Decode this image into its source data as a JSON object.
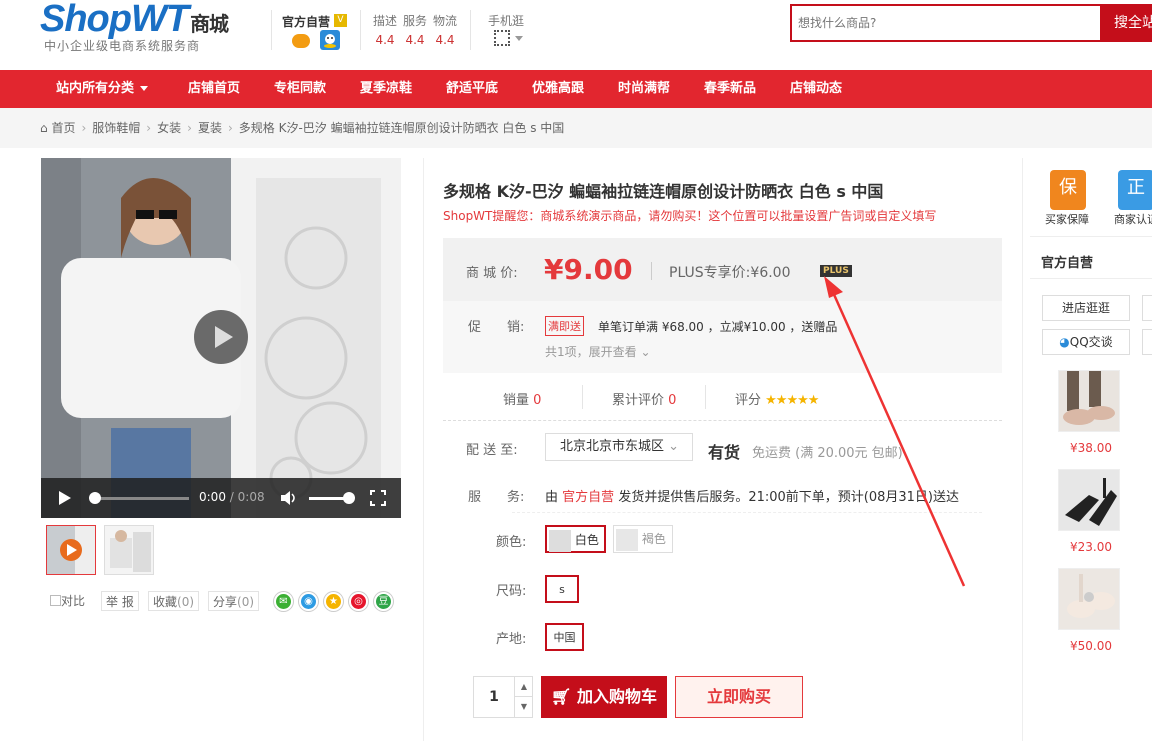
{
  "header": {
    "logo_text": "ShopWT",
    "logo_suffix": "商城",
    "logo_slogan": "中小企业级电商系统服务商",
    "shop_name": "官方自营",
    "shop_badge": "V",
    "scores": [
      {
        "label": "描述",
        "value": "4.4"
      },
      {
        "label": "服务",
        "value": "4.4"
      },
      {
        "label": "物流",
        "value": "4.4"
      }
    ],
    "mobile_label": "手机逛",
    "search_placeholder": "想找什么商品?",
    "search_button": "搜全站"
  },
  "nav": {
    "items": [
      "站内所有分类",
      "店铺首页",
      "专柜同款",
      "夏季凉鞋",
      "舒适平底",
      "优雅高跟",
      "时尚满帮",
      "春季新品",
      "店铺动态"
    ]
  },
  "breadcrumb": [
    "首页",
    "服饰鞋帽",
    "女装",
    "夏装",
    "多规格 K汐-巴汐 蝙蝠袖拉链连帽原创设计防晒衣 白色 s 中国"
  ],
  "video": {
    "current_time": "0:00",
    "duration": "/ 0:08",
    "progress": 0,
    "volume": 0.85
  },
  "gallery_actions": {
    "compare": "对比",
    "report": "举 报",
    "favorite": "收藏",
    "favorite_count": "(0)",
    "share": "分享",
    "share_count": "(0)",
    "share_icons": [
      {
        "name": "wechat-icon",
        "glyph": "✉",
        "color": "#3cb034"
      },
      {
        "name": "qzone-icon",
        "glyph": "◉",
        "color": "#2d9be3"
      },
      {
        "name": "star-icon",
        "glyph": "★",
        "color": "#f5b400"
      },
      {
        "name": "weibo-icon",
        "glyph": "◎",
        "color": "#e6162d"
      },
      {
        "name": "douban-icon",
        "glyph": "豆",
        "color": "#2fa548"
      }
    ]
  },
  "product": {
    "title": "多规格 K汐-巴汐 蝙蝠袖拉链连帽原创设计防晒衣 白色 s 中国",
    "notice": "ShopWT提醒您：商城系统演示商品，请勿购买！这个位置可以批量设置广告词或自定义填写",
    "price_label": "商 城 价:",
    "price": "¥9.00",
    "plus_label": "PLUS专享价:",
    "plus_price": "¥6.00",
    "plus_tag": "PLUS",
    "promo_label": "促　　销:",
    "promo_tag": "满即送",
    "promo_text": "单笔订单满 ¥68.00 ，立减¥10.00 ，送赠品",
    "promo_more": "共1项，展开查看",
    "sales_label": "销量",
    "sales_value": "0",
    "reviews_label": "累计评价",
    "reviews_value": "0",
    "rating_label": "评分",
    "rating_stars": "★★★★★",
    "ship_label": "配 送 至:",
    "ship_region": "北京北京市东城区",
    "stock": "有货",
    "freight": "免运费 (满 20.00元 包邮)",
    "service_label": "服　　务:",
    "service_prefix": "由",
    "service_shop": "官方自营",
    "service_text": "发货并提供售后服务。21:00前下单，预计(08月31日)送达",
    "color_label": "颜色:",
    "colors": [
      "白色",
      "褐色"
    ],
    "size_label": "尺码:",
    "size": "s",
    "origin_label": "产地:",
    "origin": "中国",
    "quantity": "1",
    "add_cart": "加入购物车",
    "buy_now": "立即购买"
  },
  "sidebar": {
    "service1_icon": "保",
    "service1": "买家保障",
    "service2_icon": "正",
    "service2": "商家认证",
    "shop_title": "官方自营",
    "visit_button": "进店逛逛",
    "qq_button": "QQ交谈",
    "recommend_prices": [
      "¥38.00",
      "¥23.00",
      "¥50.00"
    ]
  }
}
